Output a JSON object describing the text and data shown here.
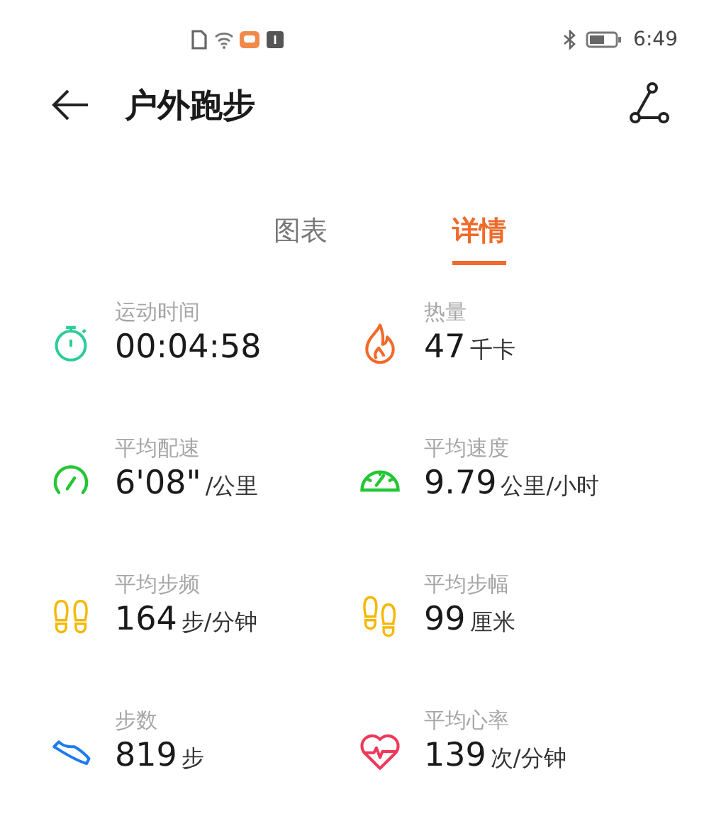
{
  "status_bar": {
    "time": "6:49"
  },
  "header": {
    "title": "户外跑步"
  },
  "tabs": [
    {
      "label": "图表",
      "selected": false
    },
    {
      "label": "详情",
      "selected": true
    }
  ],
  "metrics": [
    {
      "kind": "timer",
      "label": "运动时间",
      "value": "00:04:58"
    },
    {
      "kind": "flame",
      "label": "热量",
      "value": "47",
      "unit": "千卡"
    },
    {
      "kind": "pace",
      "label": "平均配速",
      "value": "6'08\"",
      "unit": "/公里"
    },
    {
      "kind": "speed",
      "label": "平均速度",
      "value": "9.79",
      "unit": "公里/小时"
    },
    {
      "kind": "cadence",
      "label": "平均步频",
      "value": "164",
      "unit": "步/分钟"
    },
    {
      "kind": "stride",
      "label": "平均步幅",
      "value": "99",
      "unit": "厘米"
    },
    {
      "kind": "steps",
      "label": "步数",
      "value": "819",
      "unit": "步"
    },
    {
      "kind": "heart",
      "label": "平均心率",
      "value": "139",
      "unit": "次/分钟"
    }
  ]
}
